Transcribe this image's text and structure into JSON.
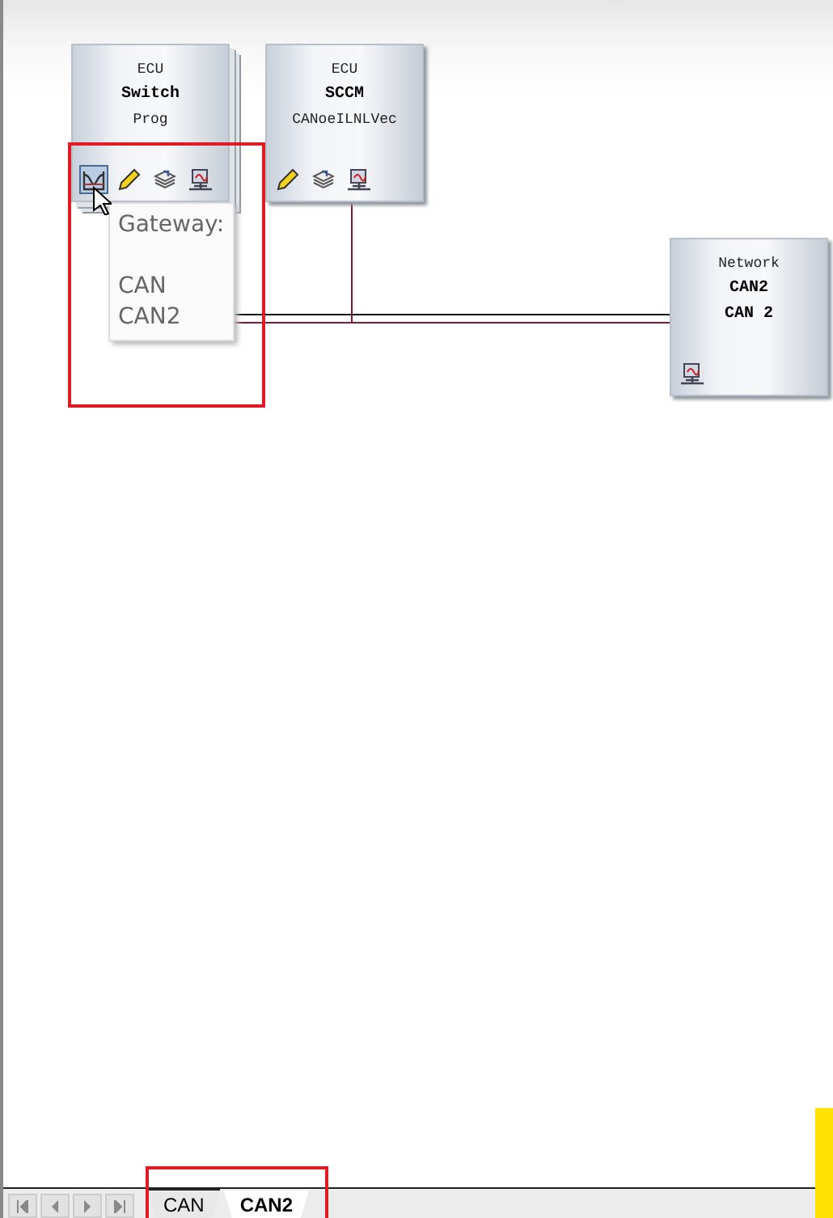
{
  "nodes": [
    {
      "kind": "ecu",
      "type_label": "ECU",
      "name": "Switch",
      "subtitle": "Prog",
      "stacked": true,
      "icons": [
        {
          "kind": "gateway",
          "selected": true
        },
        {
          "kind": "pencil",
          "selected": false
        },
        {
          "kind": "layers",
          "selected": false
        },
        {
          "kind": "network",
          "selected": false
        }
      ]
    },
    {
      "kind": "ecu",
      "type_label": "ECU",
      "name": "SCCM",
      "subtitle": "CANoeILNLVec",
      "stacked": false,
      "icons": [
        {
          "kind": "pencil",
          "selected": false
        },
        {
          "kind": "layers",
          "selected": false
        },
        {
          "kind": "network",
          "selected": false
        }
      ]
    },
    {
      "kind": "network",
      "type_label": "Network",
      "name": "CAN2",
      "subtitle": "CAN  2",
      "stacked": false,
      "icons": [
        {
          "kind": "network",
          "selected": false
        }
      ]
    }
  ],
  "tooltip": {
    "title": "Gateway:",
    "lines": [
      "CAN",
      "CAN2"
    ]
  },
  "tabs": [
    {
      "label": "CAN",
      "selected": false
    },
    {
      "label": "CAN2",
      "selected": true
    }
  ]
}
